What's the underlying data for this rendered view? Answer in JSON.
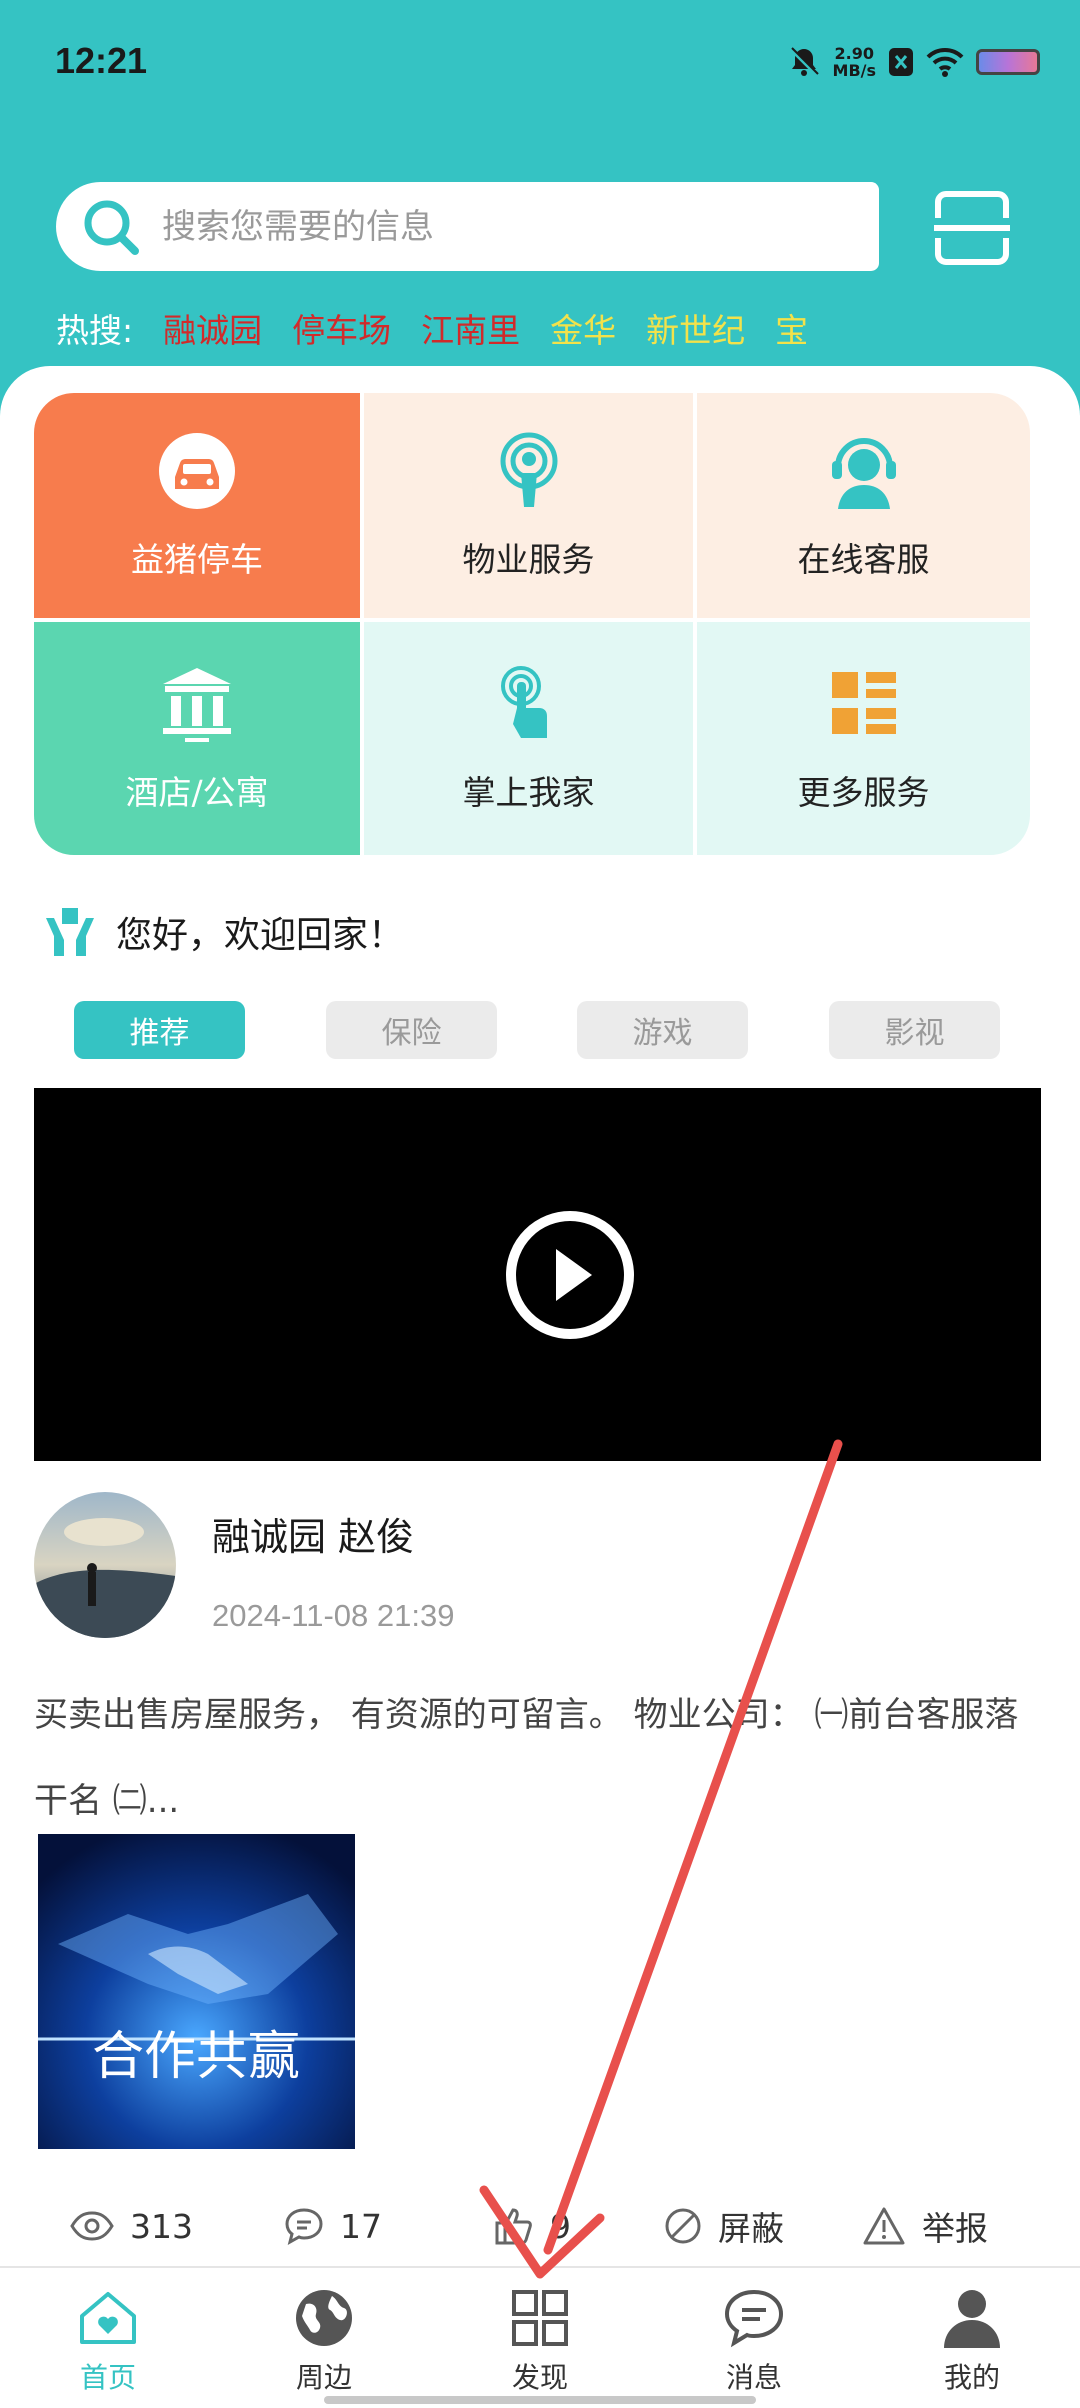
{
  "status_bar": {
    "time": "12:21",
    "net_speed_top": "2.90",
    "net_speed_unit": "MB/s"
  },
  "search": {
    "placeholder": "搜索您需要的信息"
  },
  "hot_search": {
    "label": "热搜:",
    "items": [
      {
        "text": "融诚园",
        "color": "#d12a2a"
      },
      {
        "text": "停车场",
        "color": "#d12a2a"
      },
      {
        "text": "江南里",
        "color": "#d12a2a"
      },
      {
        "text": "金华",
        "color": "#f3e24a"
      },
      {
        "text": "新世纪",
        "color": "#f3e24a"
      },
      {
        "text": "宝",
        "color": "#f3e24a"
      }
    ]
  },
  "services": [
    {
      "label": "益猪停车",
      "icon": "car-icon"
    },
    {
      "label": "物业服务",
      "icon": "broadcast-icon"
    },
    {
      "label": "在线客服",
      "icon": "headset-icon"
    },
    {
      "label": "酒店/公寓",
      "icon": "building-icon"
    },
    {
      "label": "掌上我家",
      "icon": "touch-icon"
    },
    {
      "label": "更多服务",
      "icon": "grid-list-icon"
    }
  ],
  "welcome": {
    "text": "您好，欢迎回家！"
  },
  "tabs": [
    {
      "label": "推荐",
      "active": true
    },
    {
      "label": "保险",
      "active": false
    },
    {
      "label": "游戏",
      "active": false
    },
    {
      "label": "影视",
      "active": false
    }
  ],
  "post": {
    "author": "融诚园 赵俊",
    "date": "2024-11-08 21:39",
    "text": "买卖出售房屋服务， 有资源的可留言。 物业公司： ㈠前台客服落干名 ㈡...",
    "image_text": "合作共赢",
    "views": "313",
    "comments": "17",
    "likes": "9",
    "block_label": "屏蔽",
    "report_label": "举报"
  },
  "bottom_nav": [
    {
      "label": "首页",
      "active": true
    },
    {
      "label": "周边",
      "active": false
    },
    {
      "label": "发现",
      "active": false
    },
    {
      "label": "消息",
      "active": false
    },
    {
      "label": "我的",
      "active": false
    }
  ],
  "colors": {
    "accent": "#35c3c3",
    "orange": "#f77c4d",
    "teal_tile": "#5bd6b0",
    "annotation_arrow": "#e8504c"
  }
}
